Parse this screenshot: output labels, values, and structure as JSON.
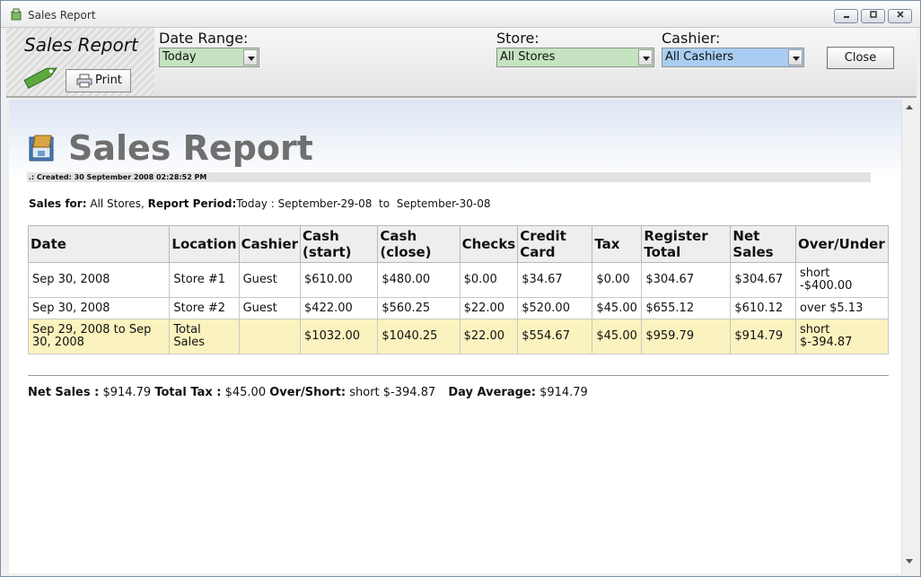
{
  "window": {
    "title": "Sales Report"
  },
  "toolbar": {
    "title": "Sales Report",
    "print_label": "Print",
    "date_range": {
      "label": "Date Range:",
      "value": "Today"
    },
    "store": {
      "label": "Store:",
      "value": "All Stores"
    },
    "cashier": {
      "label": "Cashier:",
      "value": "All Cashiers"
    },
    "close_label": "Close"
  },
  "colors": {
    "date_select": "#c5e3c0",
    "store_select": "#c5e3c0",
    "cashier_select": "#a9cdf2",
    "total_row": "#fbf3bf"
  },
  "report": {
    "title": "Sales Report",
    "created": ".: Created: 30 September 2008 02:28:52 PM",
    "sales_for_label": "Sales for:",
    "sales_for_value": " All Stores, ",
    "period_label": "Report Period:",
    "period_value": "Today : September-29-08  to  September-30-08",
    "columns": [
      "Date",
      "Location",
      "Cashier",
      "Cash (start)",
      "Cash (close)",
      "Checks",
      "Credit Card",
      "Tax",
      "Register Total",
      "Net Sales",
      "Over/Under"
    ],
    "rows": [
      [
        "Sep 30, 2008",
        "Store #1",
        "Guest",
        "$610.00",
        "$480.00",
        "$0.00",
        "$34.67",
        "$0.00",
        "$304.67",
        "$304.67",
        "short -$400.00"
      ],
      [
        "Sep 30, 2008",
        "Store #2",
        "Guest",
        "$422.00",
        "$560.25",
        "$22.00",
        "$520.00",
        "$45.00",
        "$655.12",
        "$610.12",
        "over $5.13"
      ]
    ],
    "total_row": [
      "Sep 29, 2008  to  Sep 30, 2008",
      "Total Sales",
      "",
      "$1032.00",
      "$1040.25",
      "$22.00",
      "$554.67",
      "$45.00",
      "$959.79",
      "$914.79",
      "short $-394.87"
    ],
    "summary": {
      "net_sales_label": "Net Sales :",
      "net_sales_value": " $914.79 ",
      "total_tax_label": "Total Tax :",
      "total_tax_value": " $45.00 ",
      "over_short_label": "Over/Short:",
      "over_short_value": " short $-394.87 ",
      "day_average_label": "Day Average:",
      "day_average_value": " $914.79"
    }
  }
}
